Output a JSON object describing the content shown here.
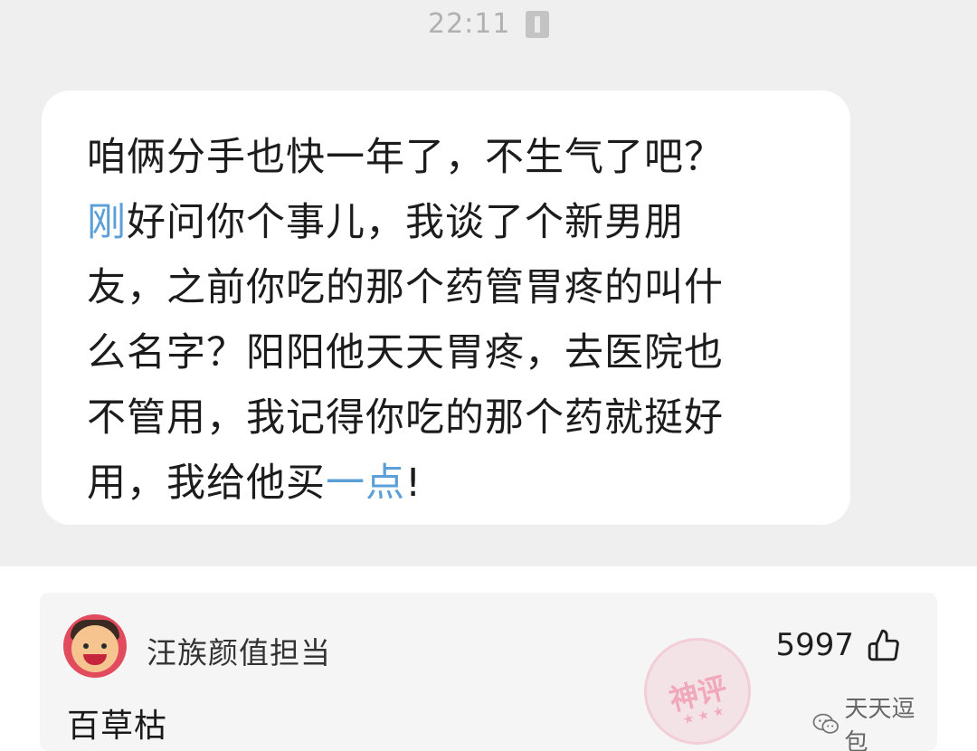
{
  "chat": {
    "timestamp": "22:11",
    "message_lines": [
      [
        {
          "text": "咱俩分手也快一年了，不生气了吧？",
          "highlight": false
        }
      ],
      [
        {
          "text": "刚",
          "highlight": true
        },
        {
          "text": "好问你个事儿，我谈了个新男朋",
          "highlight": false
        }
      ],
      [
        {
          "text": "友，之前你吃的那个药管胃疼的叫什",
          "highlight": false
        }
      ],
      [
        {
          "text": "么名字？阳阳他天天胃疼，去医院也",
          "highlight": false
        }
      ],
      [
        {
          "text": "不管用，我记得你吃的那个药就挺好",
          "highlight": false
        }
      ],
      [
        {
          "text": "用，我给他买",
          "highlight": false
        },
        {
          "text": "一点",
          "highlight": true
        },
        {
          "text": "!",
          "highlight": false
        }
      ]
    ]
  },
  "comment": {
    "username": "汪族颜值担当",
    "like_count": "5997",
    "text": "百草枯",
    "stamp_text": "神评",
    "stamp_stars": "★ ★ ★",
    "watermark": "天天逗包"
  },
  "colors": {
    "chat_background": "#efefef",
    "bubble_background": "#ffffff",
    "highlight_text": "#5b9fd8",
    "comment_card_background": "#f5f5f5",
    "avatar_background": "#e24a5e",
    "stamp_color": "#ec7896"
  },
  "icons": {
    "timestamp_icon": "phone-signal-icon",
    "like_icon": "thumbs-up-icon",
    "watermark_icon": "wechat-icon",
    "stamp_icon": "shen-ping-stamp-icon"
  }
}
